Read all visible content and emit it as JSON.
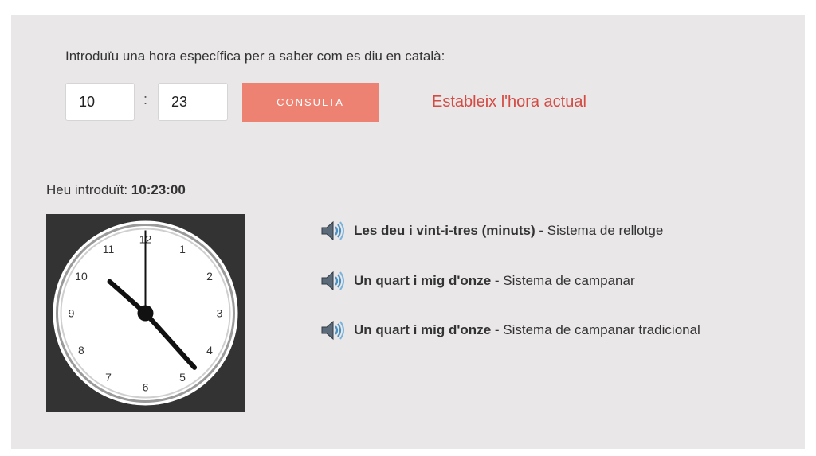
{
  "prompt": "Introduïu una hora específica per a saber com es diu en català:",
  "form": {
    "hour": "10",
    "separator": ":",
    "minute": "23",
    "submit_label": "CONSULTA",
    "set_now_label": "Estableix l'hora actual"
  },
  "entered": {
    "label": "Heu introduït: ",
    "time": "10:23:00"
  },
  "clock": {
    "hours": 10,
    "minutes": 23,
    "seconds": 0,
    "numbers": [
      "12",
      "1",
      "2",
      "3",
      "4",
      "5",
      "6",
      "7",
      "8",
      "9",
      "10",
      "11"
    ]
  },
  "results": [
    {
      "icon": "speaker-icon",
      "phrase": "Les deu i vint-i-tres (minuts)",
      "system": " - Sistema de rellotge"
    },
    {
      "icon": "speaker-icon",
      "phrase": "Un quart i mig d'onze",
      "system": " - Sistema de campanar"
    },
    {
      "icon": "speaker-icon",
      "phrase": "Un quart i mig d'onze",
      "system": " - Sistema de campanar tradicional"
    }
  ],
  "colors": {
    "panel": "#e9e7e8",
    "button": "#ee8272",
    "link": "#d44b44",
    "clock_bg": "#333333"
  }
}
